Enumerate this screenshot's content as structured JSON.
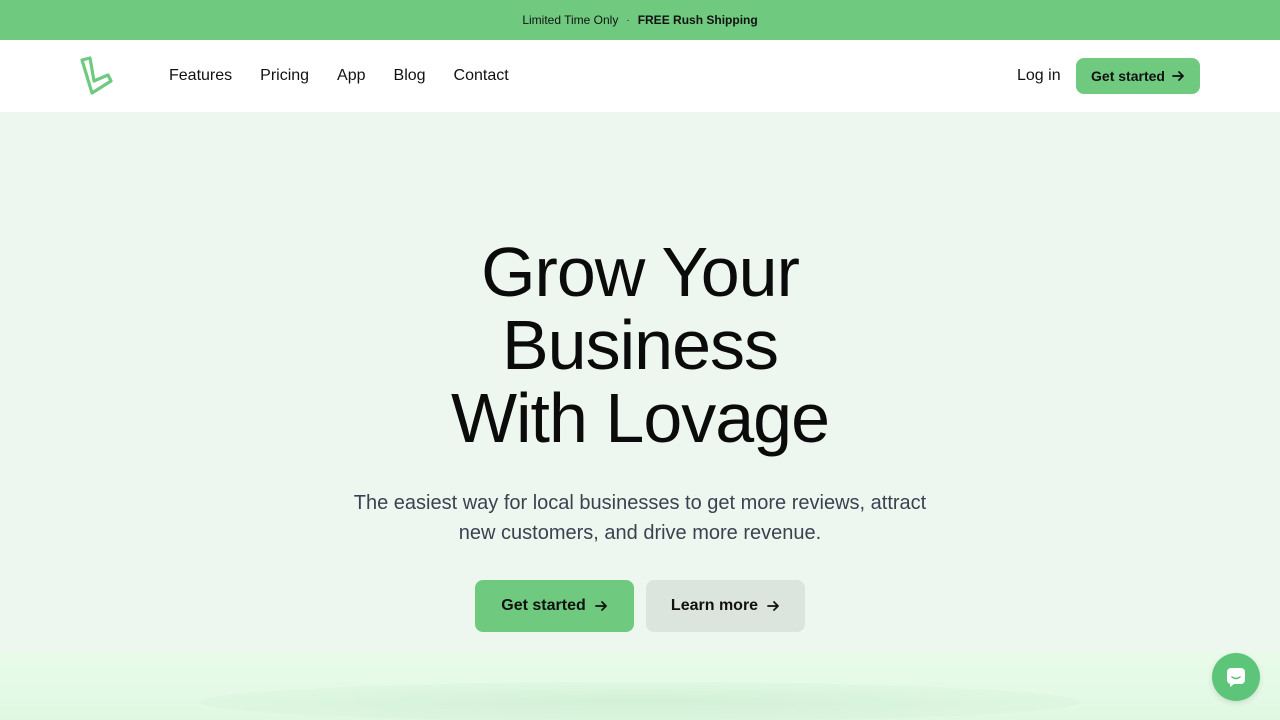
{
  "promo": {
    "left": "Limited Time Only",
    "separator": "·",
    "right": "FREE Rush Shipping"
  },
  "nav": {
    "logo_icon": "lovage-logo-icon",
    "items": [
      {
        "label": "Features"
      },
      {
        "label": "Pricing"
      },
      {
        "label": "App"
      },
      {
        "label": "Blog"
      },
      {
        "label": "Contact"
      }
    ],
    "login_label": "Log in",
    "cta_label": "Get started"
  },
  "hero": {
    "headline": [
      "Grow Your",
      "Business",
      "With Lovage"
    ],
    "subheadline": [
      "The easiest way for local businesses to get more reviews, attract",
      "new customers, and drive more revenue."
    ],
    "primary_button": "Get started",
    "secondary_button": "Learn more"
  },
  "chat": {
    "icon": "chat-icon"
  },
  "colors": {
    "brand_green": "#6fca7f",
    "hero_bg": "#eef7ef",
    "secondary_button_bg": "#dce5dd",
    "chat_bubble": "#5cc57a"
  }
}
